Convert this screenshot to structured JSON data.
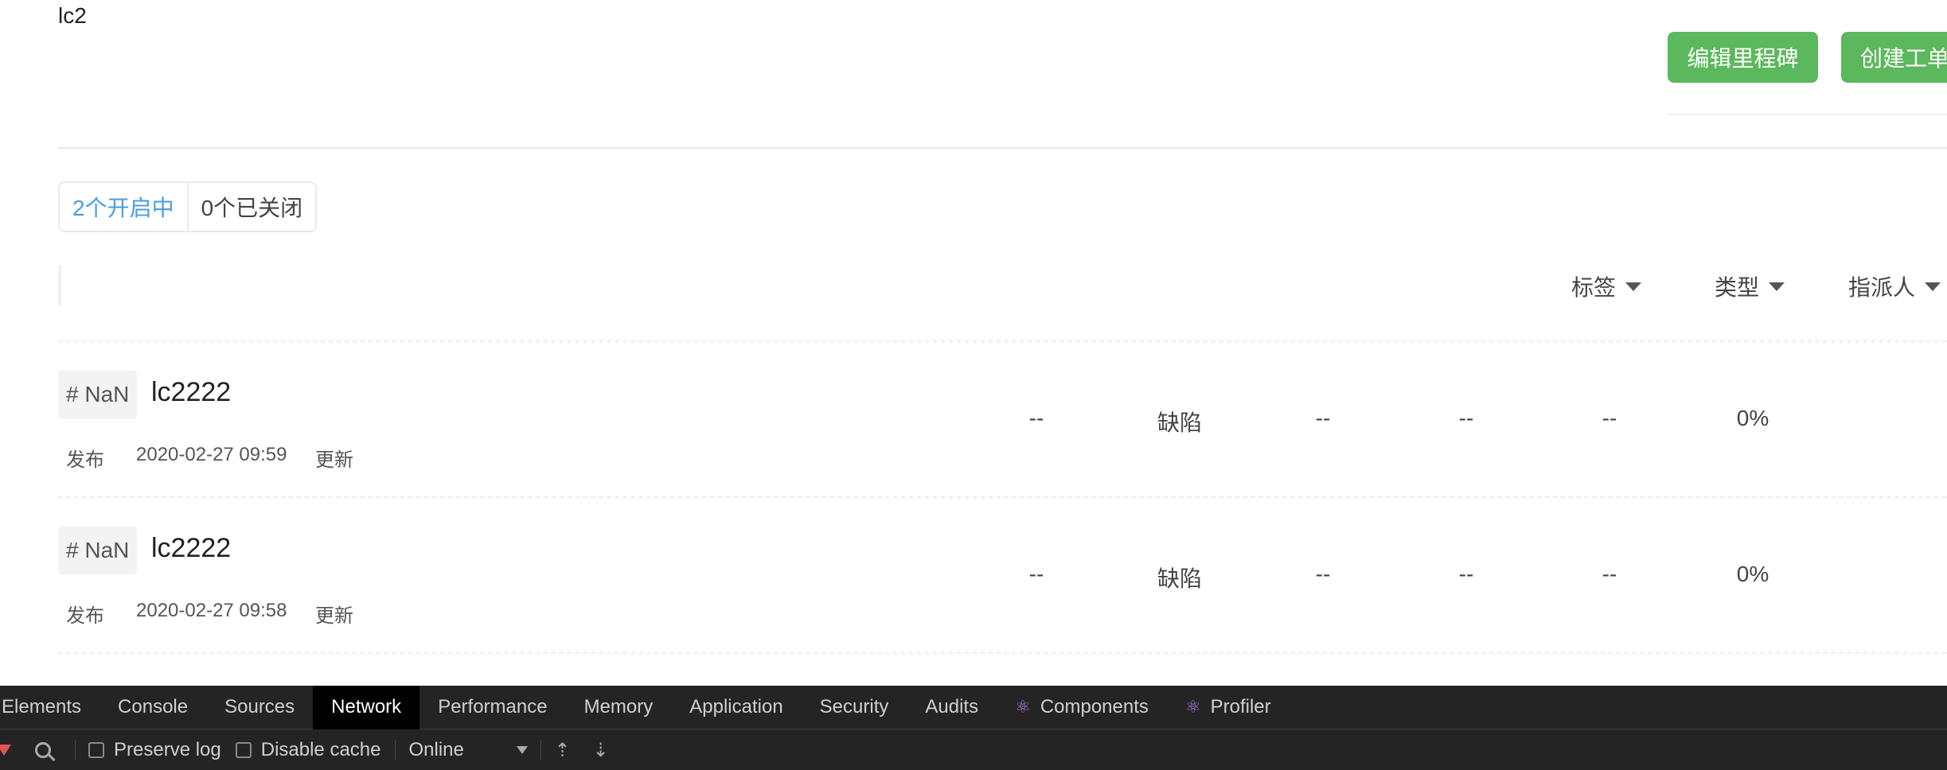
{
  "milestone": {
    "title": "lc2"
  },
  "buttons": {
    "edit": "编辑里程碑",
    "create": "创建工单"
  },
  "state_tabs": {
    "open": "2个开启中",
    "closed": "0个已关闭"
  },
  "filters": {
    "label": "标签",
    "type": "类型",
    "assignee": "指派人"
  },
  "rows": [
    {
      "num": "# NaN",
      "title": "lc2222",
      "status": "发布",
      "date": "2020-02-27 09:59",
      "updated": "更新",
      "cells": [
        "--",
        "缺陷",
        "--",
        "--",
        "--",
        "0%"
      ]
    },
    {
      "num": "# NaN",
      "title": "lc2222",
      "status": "发布",
      "date": "2020-02-27 09:58",
      "updated": "更新",
      "cells": [
        "--",
        "缺陷",
        "--",
        "--",
        "--",
        "0%"
      ]
    }
  ],
  "devtools": {
    "tabs": [
      "Elements",
      "Console",
      "Sources",
      "Network",
      "Performance",
      "Memory",
      "Application",
      "Security",
      "Audits",
      "Components",
      "Profiler"
    ],
    "active_tab": "Network",
    "preserve_log": "Preserve log",
    "disable_cache": "Disable cache",
    "throttling": "Online",
    "icons": [
      "filter-icon",
      "search-icon",
      "import-icon",
      "export-icon",
      "react-icon"
    ]
  },
  "colors": {
    "primary_button": "#5cb85c",
    "active_tab_text": "#4a9de0",
    "devtools_bg": "#242424",
    "filter_icon": "#e05353"
  }
}
